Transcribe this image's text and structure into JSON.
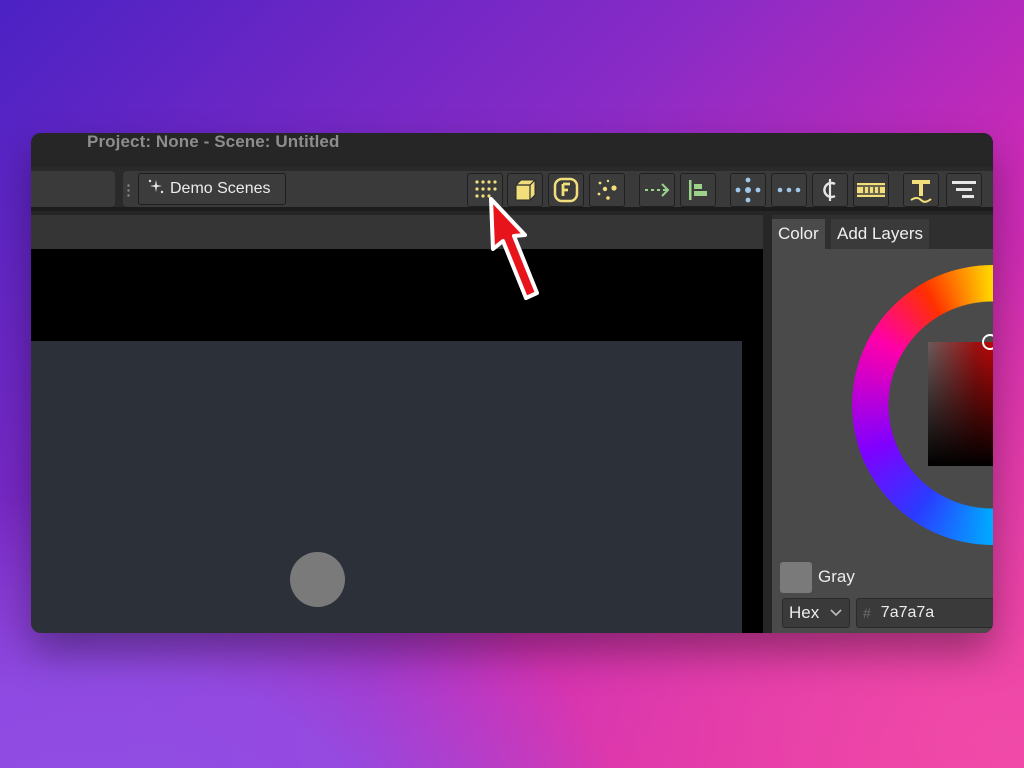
{
  "window": {
    "title": "Project: None - Scene: Untitled"
  },
  "toolbar": {
    "demo_scenes_label": "Demo Scenes",
    "tools": [
      {
        "icon": "grid-dots-icon"
      },
      {
        "icon": "cube-icon"
      },
      {
        "icon": "f-badge-icon"
      },
      {
        "icon": "particles-icon"
      },
      {
        "icon": "dashed-arrow-icon"
      },
      {
        "icon": "align-left-icon"
      },
      {
        "icon": "move-cross-icon"
      },
      {
        "icon": "dots-line-icon"
      },
      {
        "icon": "cent-icon"
      },
      {
        "icon": "film-strip-icon"
      },
      {
        "icon": "text-tool-icon"
      },
      {
        "icon": "stairs-icon"
      }
    ]
  },
  "panel": {
    "tabs": [
      {
        "label": "Color",
        "active": true
      },
      {
        "label": "Add Layers",
        "active": false
      }
    ],
    "swatch_color": "#7a7a7a",
    "swatch_label": "Gray",
    "format_select": "Hex",
    "hex_value": "7a7a7a",
    "hash_symbol": "#"
  },
  "colors": {
    "accent_yellow": "#f2df7c",
    "accent_green": "#9bd38a",
    "accent_blue": "#9ec7ea",
    "annotation_red": "#e8141c"
  }
}
